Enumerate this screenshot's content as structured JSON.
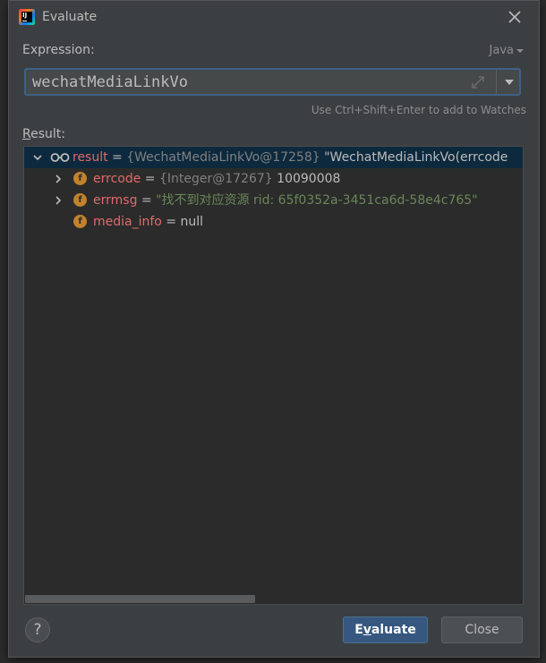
{
  "window": {
    "title": "Evaluate"
  },
  "expression": {
    "label": "Expression:",
    "language": "Java",
    "value": "wechatMediaLinkVo",
    "hint": "Use Ctrl+Shift+Enter to add to Watches"
  },
  "result": {
    "label_prefix": "R",
    "label_rest": "esult:",
    "rows": [
      {
        "name": "result",
        "eq": " = ",
        "type": "{WechatMediaLinkVo@17258} ",
        "value": "\"WechatMediaLinkVo(errcode"
      },
      {
        "name": "errcode",
        "eq": " = ",
        "type": "{Integer@17267} ",
        "value": "10090008"
      },
      {
        "name": "errmsg",
        "eq": " = ",
        "type": "",
        "value": "\"找不到对应资源 rid: 65f0352a-3451ca6d-58e4c765\""
      },
      {
        "name": "media_info",
        "eq": " = ",
        "type": "",
        "value": "null"
      }
    ]
  },
  "buttons": {
    "help": "?",
    "evaluate_prefix": "E",
    "evaluate_underlined": "v",
    "evaluate_rest": "aluate",
    "close": "Close"
  },
  "icons": {
    "app": "intellij-icon",
    "close": "close-icon",
    "expand": "expand-icon",
    "dropdown": "chevron-down-icon",
    "watch": "glasses-icon",
    "field": "field-icon"
  },
  "colors": {
    "accent": "#365880",
    "field_name": "#e16a6a",
    "string": "#6a8759",
    "selection": "#0d293e"
  }
}
